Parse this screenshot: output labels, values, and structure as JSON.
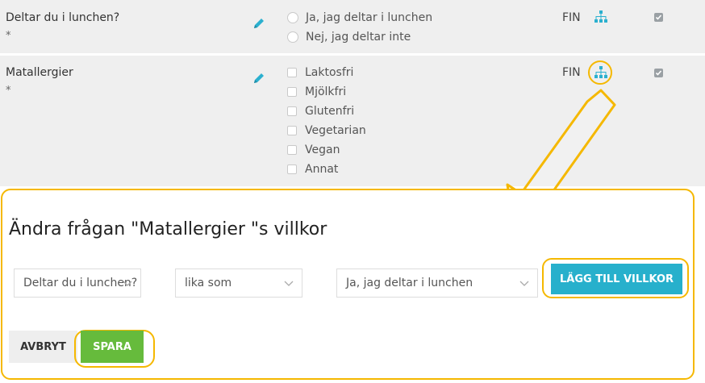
{
  "questions": [
    {
      "title": "Deltar du i lunchen?",
      "required": "*",
      "lang": "FIN",
      "options": [
        "Ja, jag deltar i lunchen",
        "Nej, jag deltar inte"
      ]
    },
    {
      "title": "Matallergier",
      "required": "*",
      "lang": "FIN",
      "options": [
        "Laktosfri",
        "Mjölkfri",
        "Glutenfri",
        "Vegetarian",
        "Vegan",
        "Annat"
      ]
    }
  ],
  "panel": {
    "title": "Ändra frågan \"Matallergier \"s villkor",
    "question_select": "Deltar du i lunchen?",
    "operator_select": "lika som",
    "answer_select": "Ja, jag deltar i lunchen",
    "add_condition_label": "LÄGG TILL VILLKOR",
    "cancel_label": "AVBRYT",
    "save_label": "SPARA"
  },
  "colors": {
    "highlight": "#f5b800",
    "accent": "#27b0cc",
    "save": "#66bb3c",
    "row_bg": "#efefef"
  },
  "icons": {
    "edit": "pencil-icon",
    "conditions": "sitemap-icon",
    "dropdown": "chevron-down-icon"
  }
}
